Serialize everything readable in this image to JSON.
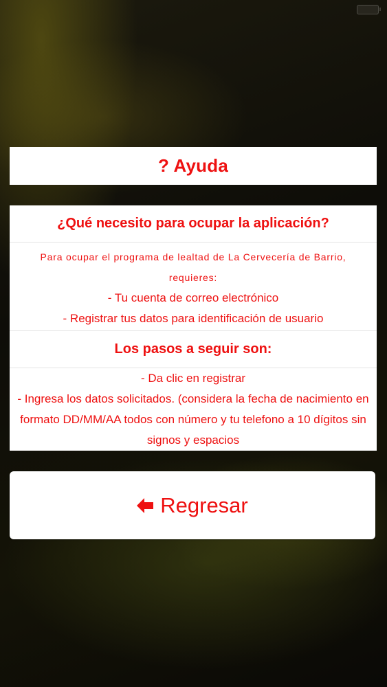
{
  "colors": {
    "accent": "#ee1111",
    "card_background": "#ffffff"
  },
  "title_card": {
    "icon": "question-mark-icon",
    "text": "? Ayuda"
  },
  "help": {
    "question": "¿Qué necesito para ocupar la aplicación?",
    "intro": "Para ocupar el programa de lealtad de La Cervecería de Barrio, requieres:",
    "requirements": [
      "- Tu cuenta de correo electrónico",
      "- Registrar tus datos para identificación de usuario"
    ],
    "steps_title": "Los pasos a seguir son:",
    "steps": [
      "- Da clic en registrar",
      "- Ingresa los datos solicitados. (considera la fecha de nacimiento en formato DD/MM/AA todos con número y tu telefono a 10 dígitos sin signos y espacios"
    ]
  },
  "back_button": {
    "icon": "arrow-left-icon",
    "label": "Regresar"
  }
}
